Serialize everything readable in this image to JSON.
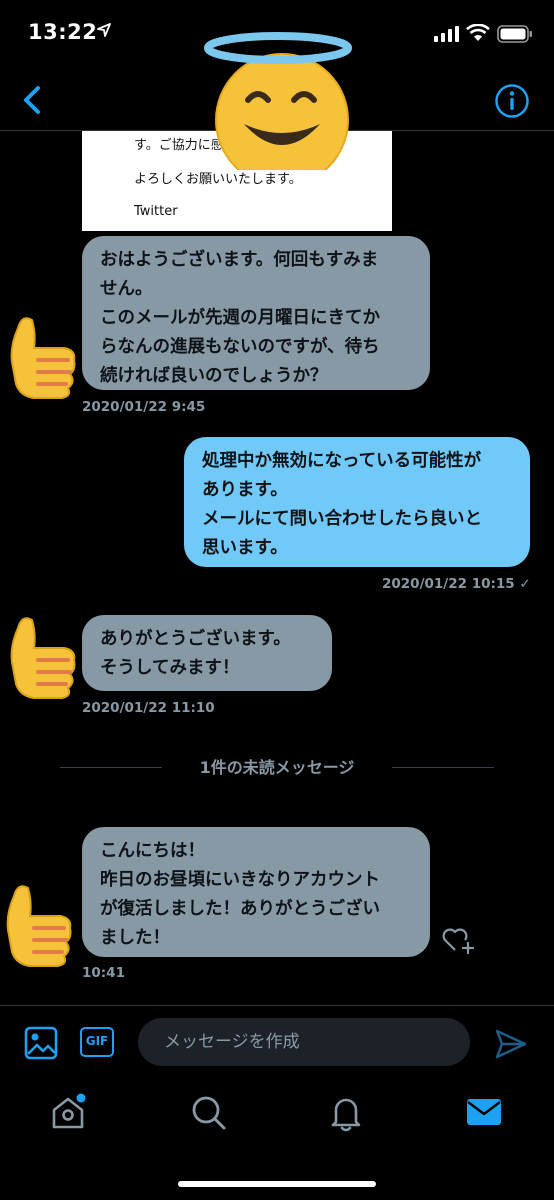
{
  "status_bar": {
    "time": "13:22"
  },
  "email_card": {
    "lines": [
      "す。ご協力に感",
      "よろしくお願いいたします。",
      "Twitter"
    ]
  },
  "messages": [
    {
      "direction": "incoming",
      "lines": [
        "おはようございます。何回もすみま",
        "せん。",
        "このメールが先週の月曜日にきてか",
        "らなんの進展もないのですが、待ち",
        "続ければ良いのでしょうか？"
      ],
      "timestamp": "2020/01/22 9:45"
    },
    {
      "direction": "outgoing",
      "lines": [
        "処理中か無効になっている可能性が",
        "あります。",
        "メールにて問い合わせしたら良いと",
        "思います。"
      ],
      "timestamp": "2020/01/22 10:15 ✓"
    },
    {
      "direction": "incoming",
      "lines": [
        "ありがとうございます。",
        "そうしてみます！"
      ],
      "timestamp": "2020/01/22 11:10"
    },
    {
      "direction": "incoming",
      "lines": [
        "こんにちは！",
        "昨日のお昼頃にいきなりアカウント",
        "が復活しました！ありがとうござい",
        "ました！"
      ],
      "timestamp": "10:41"
    }
  ],
  "unread_divider": "1件の未読メッセージ",
  "composer": {
    "placeholder": "メッセージを作成",
    "gif_label": "GIF"
  },
  "colors": {
    "accent": "#1da1f2",
    "incoming_bubble": "#8899a6",
    "outgoing_bubble": "#71c9f8",
    "background": "#000000"
  },
  "icons": [
    "back-chevron-icon",
    "info-icon",
    "heart-plus-icon",
    "image-icon",
    "gif-icon",
    "send-icon",
    "home-icon",
    "search-icon",
    "bell-icon",
    "mail-icon"
  ]
}
